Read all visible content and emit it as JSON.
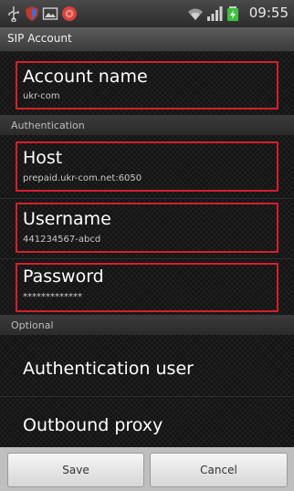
{
  "status_bar": {
    "time": "09:55",
    "icons": [
      "usb-icon",
      "shield-icon",
      "picture-icon",
      "app-icon",
      "wifi-icon",
      "signal-icon",
      "battery-icon"
    ]
  },
  "title_bar": {
    "title": "SIP Account"
  },
  "preferences": {
    "account_name": {
      "title": "Account name",
      "summary": "ukr-com"
    },
    "authentication_header": "Authentication",
    "host": {
      "title": "Host",
      "summary": "prepaid.ukr-com.net:6050"
    },
    "username": {
      "title": "Username",
      "summary": "441234567-abcd"
    },
    "password": {
      "title": "Password",
      "summary": "*************"
    },
    "optional_header": "Optional",
    "authentication_user": {
      "title": "Authentication user"
    },
    "outbound_proxy": {
      "title": "Outbound proxy"
    }
  },
  "buttons": {
    "save": "Save",
    "cancel": "Cancel"
  },
  "colors": {
    "highlight": "#d61f2c",
    "battery": "#3fbf3f"
  }
}
